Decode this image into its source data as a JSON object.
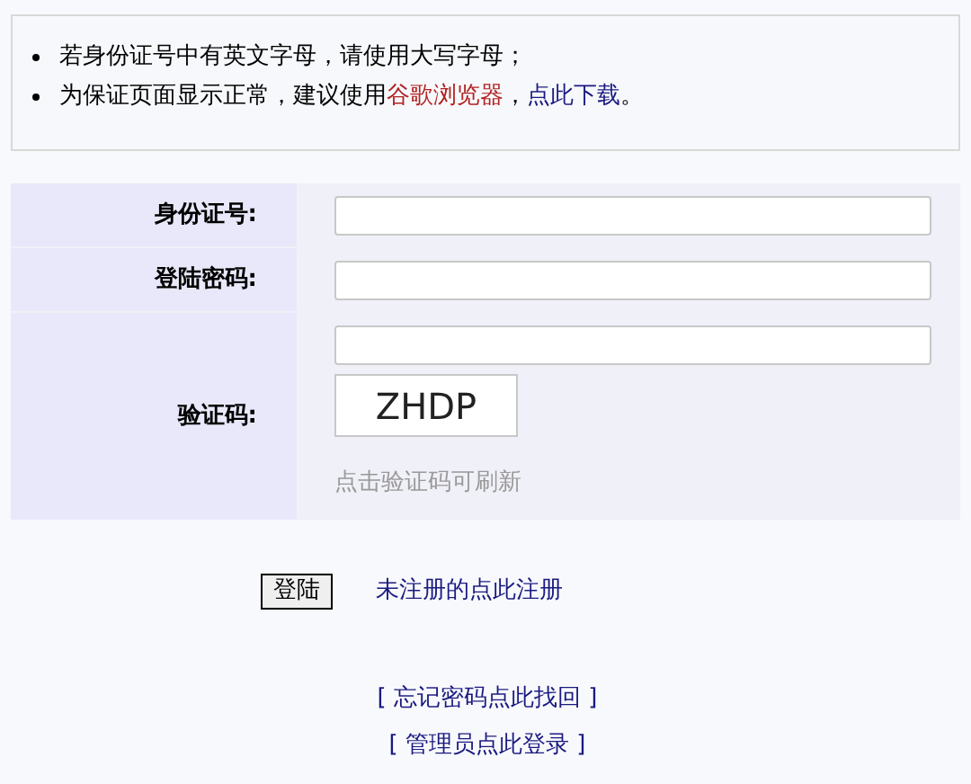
{
  "notes": [
    {
      "parts": [
        {
          "kind": "plain",
          "text": "若身份证号中有英文字母，请使用大写字母；"
        }
      ]
    },
    {
      "parts": [
        {
          "kind": "plain",
          "text": "为保证页面显示正常，建议使用"
        },
        {
          "kind": "highlight",
          "text": "谷歌浏览器"
        },
        {
          "kind": "plain",
          "text": "，"
        },
        {
          "kind": "link",
          "text": "点此下载"
        },
        {
          "kind": "plain",
          "text": "。"
        }
      ]
    }
  ],
  "form": {
    "rows": [
      {
        "kind": "text",
        "label": "身份证号:"
      },
      {
        "kind": "password",
        "label": "登陆密码:"
      },
      {
        "kind": "captcha",
        "label": "验证码:",
        "captcha": "ZHDP",
        "hint": "点击验证码可刷新"
      }
    ]
  },
  "login_button": "登陆",
  "register_link": "未注册的点此注册",
  "links": [
    "[ 忘记密码点此找回 ]",
    "[ 管理员点此登录 ]"
  ]
}
